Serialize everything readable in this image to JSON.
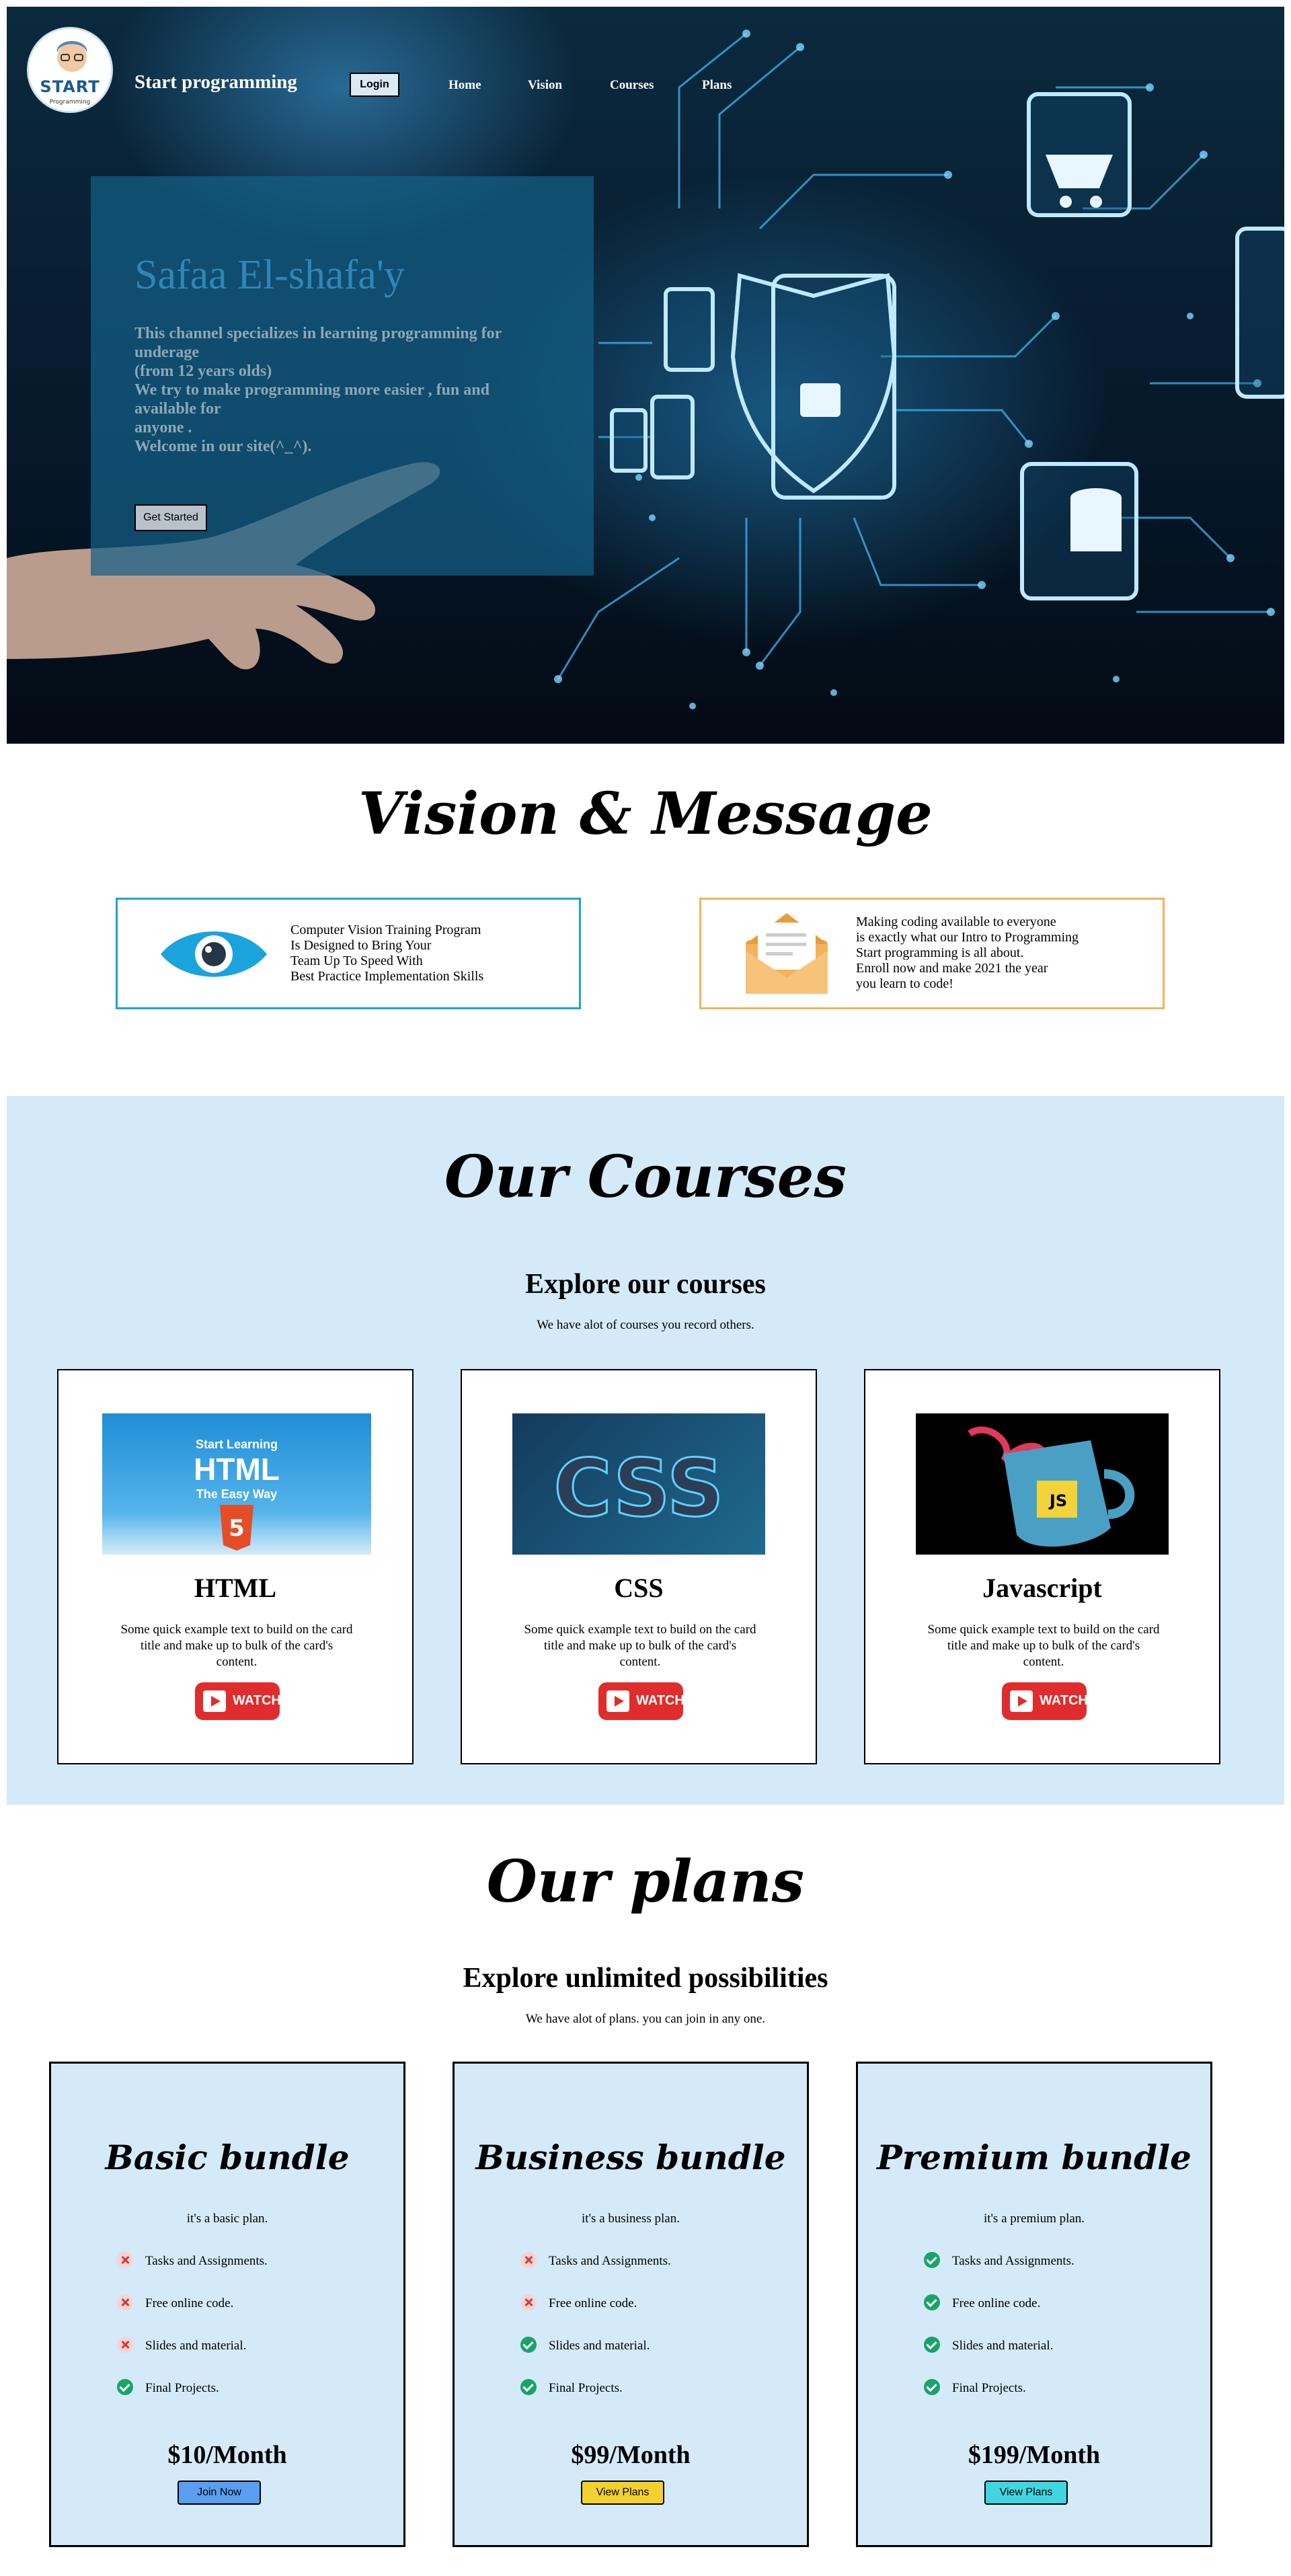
{
  "header": {
    "logo_text": "START",
    "logo_sub": "Programming",
    "brand": "Start programming",
    "login_label": "Login",
    "nav": [
      "Home",
      "Vision",
      "Courses",
      "Plans"
    ]
  },
  "hero": {
    "name": "Safaa El-shafa'y",
    "description": "This channel specializes in learning programming for underage\n(from 12 years olds)\nWe try to make programming more easier , fun and available for\nanyone .\nWelcome in our site(^_^).",
    "cta_label": "Get Started"
  },
  "vision": {
    "title": "Vision & Message",
    "cards": [
      {
        "text": "Computer Vision Training Program\nIs Designed to Bring Your\nTeam Up To Speed With\nBest Practice Implementation Skills",
        "icon": "eye-icon"
      },
      {
        "text": "Making coding available to everyone\nis exactly what our Intro to Programming\nStart programming is all about.\nEnroll now and make 2021 the year\nyou learn to code!",
        "icon": "envelope-icon"
      }
    ]
  },
  "courses": {
    "title": "Our Courses",
    "subtitle": "Explore our courses",
    "text": "We have alot of courses you record others.",
    "watch_label": "WATCH",
    "items": [
      {
        "name": "HTML",
        "desc": "Some quick example text to build on the card title and make up to bulk of the card's content.",
        "thumb_lines": [
          "Start Learning",
          "HTML",
          "The Easy Way"
        ]
      },
      {
        "name": "CSS",
        "desc": "Some quick example text to build on the card title and make up to bulk of the card's content.",
        "thumb_lines": [
          "CSS"
        ]
      },
      {
        "name": "Javascript",
        "desc": "Some quick example text to build on the card title and make up to bulk of the card's content.",
        "thumb_lines": [
          "JS"
        ]
      }
    ]
  },
  "plans": {
    "title": "Our plans",
    "subtitle": "Explore unlimited possibilities",
    "text": "We have alot of plans. you can join in any one.",
    "items": [
      {
        "name": "Basic bundle",
        "desc": "it's a basic plan.",
        "price": "$10/Month",
        "button": "Join Now",
        "button_color": "#5a9ef0",
        "features": [
          {
            "label": "Tasks and Assignments.",
            "included": false
          },
          {
            "label": "Free online code.",
            "included": false
          },
          {
            "label": "Slides and material.",
            "included": false
          },
          {
            "label": "Final Projects.",
            "included": true
          }
        ]
      },
      {
        "name": "Business bundle",
        "desc": "it's a business plan.",
        "price": "$99/Month",
        "button": "View Plans",
        "button_color": "#f2d12e",
        "features": [
          {
            "label": "Tasks and Assignments.",
            "included": false
          },
          {
            "label": "Free online code.",
            "included": false
          },
          {
            "label": "Slides and material.",
            "included": true
          },
          {
            "label": "Final Projects.",
            "included": true
          }
        ]
      },
      {
        "name": "Premium bundle",
        "desc": "it's a premium plan.",
        "price": "$199/Month",
        "button": "View Plans",
        "button_color": "#3fd6e0",
        "features": [
          {
            "label": "Tasks and Assignments.",
            "included": true
          },
          {
            "label": "Free online code.",
            "included": true
          },
          {
            "label": "Slides and material.",
            "included": true
          },
          {
            "label": "Final Projects.",
            "included": true
          }
        ]
      }
    ]
  },
  "colors": {
    "vision_left_border": "#1aa3dd",
    "vision_right_border": "#f4b35a",
    "section_bg": "#d4eaf8",
    "watch_red": "#e02c2c"
  }
}
